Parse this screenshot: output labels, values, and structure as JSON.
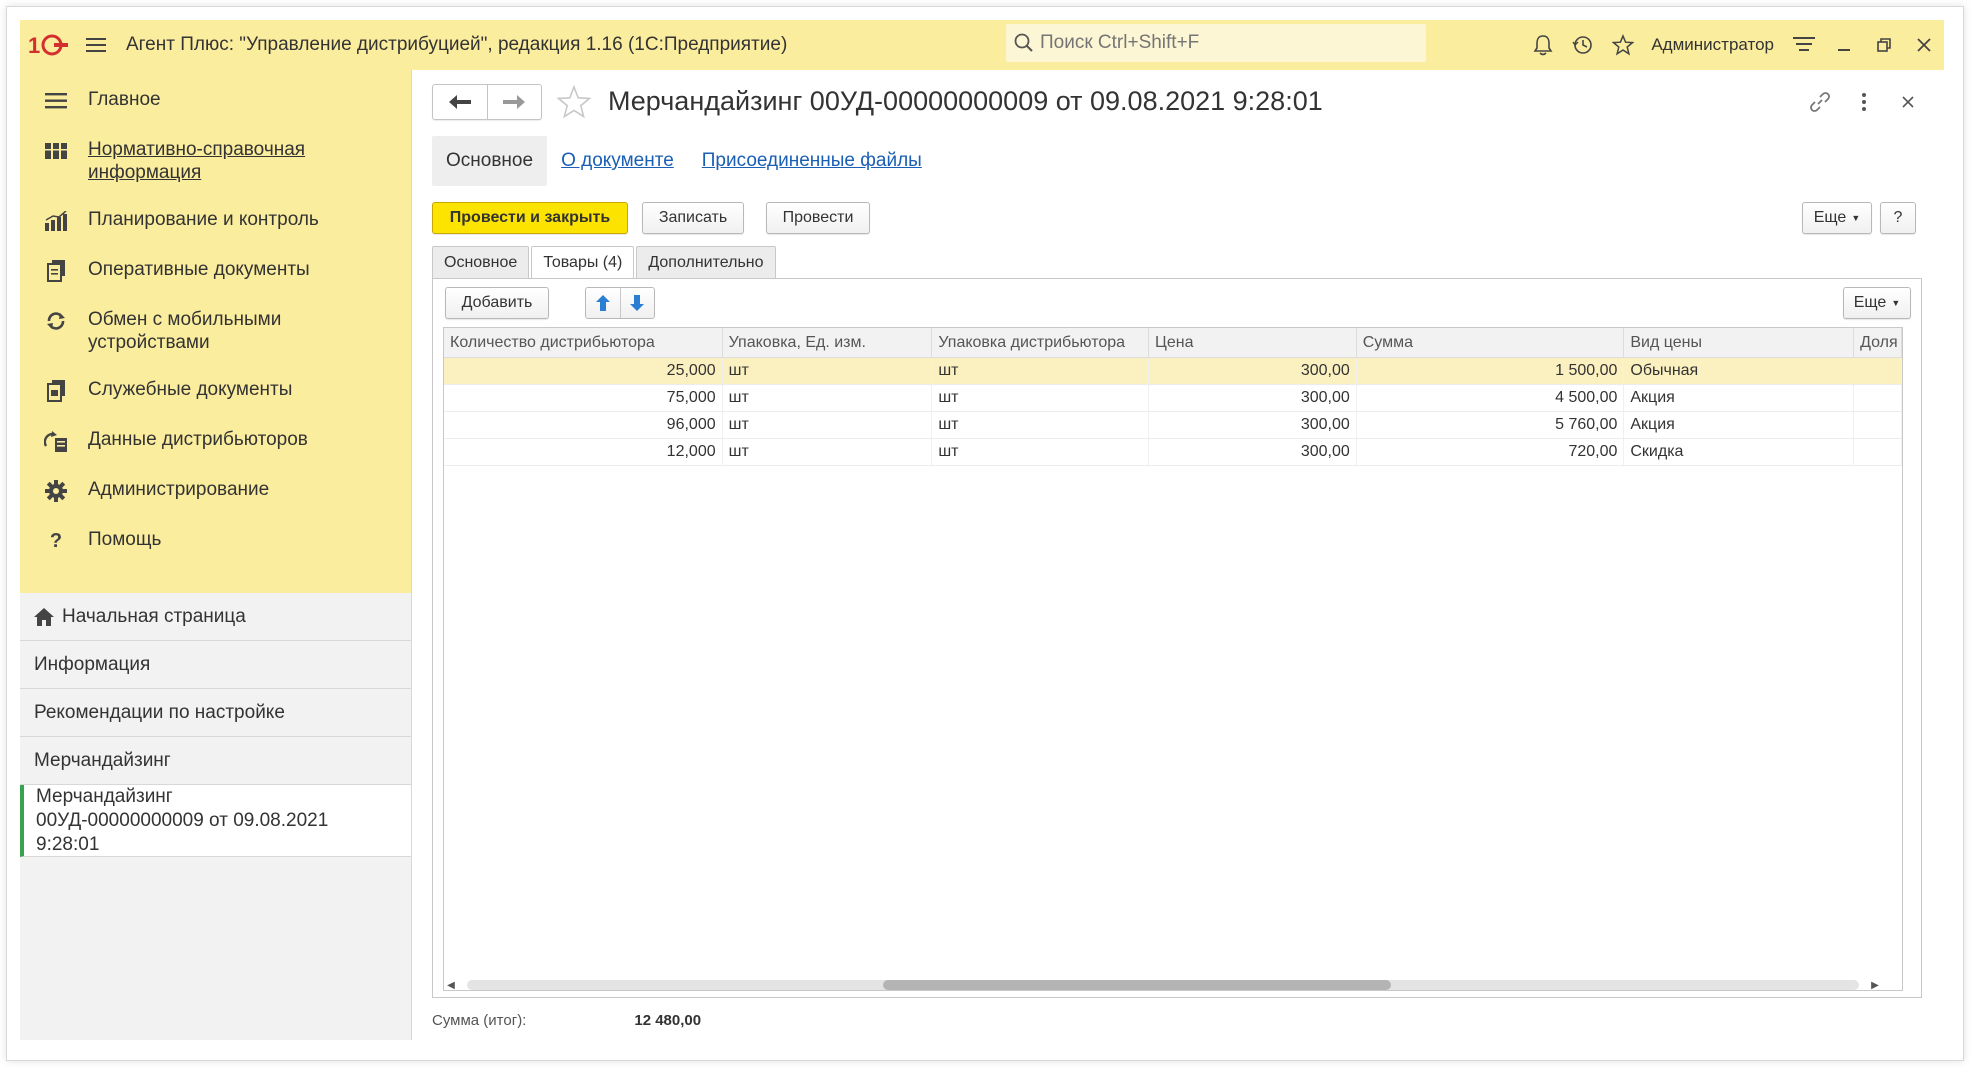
{
  "app": {
    "title": "Агент Плюс: \"Управление дистрибуцией\", редакция 1.16  (1С:Предприятие)",
    "search_placeholder": "Поиск Ctrl+Shift+F",
    "user": "Администратор",
    "brand_color": "#fbed9e"
  },
  "sidebar": {
    "sections": [
      {
        "label": "Главное",
        "icon": "menu-lines-icon"
      },
      {
        "label": "Нормативно-справочная информация",
        "icon": "catalog-grid-icon",
        "link": true
      },
      {
        "label": "Планирование и контроль",
        "icon": "bar-chart-icon"
      },
      {
        "label": "Оперативные документы",
        "icon": "documents-icon"
      },
      {
        "label": "Обмен с мобильными устройствами",
        "icon": "sync-icon"
      },
      {
        "label": "Служебные документы",
        "icon": "service-docs-icon"
      },
      {
        "label": "Данные дистрибьюторов",
        "icon": "distributor-data-icon"
      },
      {
        "label": "Администрирование",
        "icon": "gear-icon"
      },
      {
        "label": "Помощь",
        "icon": "question-icon"
      }
    ],
    "open_windows": [
      {
        "label": "Начальная страница",
        "icon": "home-icon"
      },
      {
        "label": "Информация"
      },
      {
        "label": "Рекомендации по настройке"
      },
      {
        "label": "Мерчандайзинг"
      },
      {
        "label": "Мерчандайзинг 00УД-00000000009 от 09.08.2021 9:28:01",
        "active": true
      }
    ]
  },
  "document": {
    "title": "Мерчандайзинг 00УД-00000000009 от 09.08.2021 9:28:01",
    "form_tabs": [
      "Основное",
      "О документе",
      "Присоединенные файлы"
    ],
    "commands": {
      "post_close": "Провести и закрыть",
      "save": "Записать",
      "post": "Провести",
      "more": "Еще",
      "help": "?"
    },
    "page_tabs": [
      "Основное",
      "Товары (4)",
      "Дополнительно"
    ],
    "table_commands": {
      "add": "Добавить",
      "more": "Еще"
    },
    "table": {
      "columns": [
        "Количество дистрибьютора",
        "Упаковка, Ед. изм.",
        "Упаковка дистрибьютора",
        "Цена",
        "Сумма",
        "Вид цены",
        "Доля"
      ],
      "rows": [
        [
          "25,000",
          "шт",
          "шт",
          "300,00",
          "1 500,00",
          "Обычная",
          ""
        ],
        [
          "75,000",
          "шт",
          "шт",
          "300,00",
          "4 500,00",
          "Акция",
          ""
        ],
        [
          "96,000",
          "шт",
          "шт",
          "300,00",
          "5 760,00",
          "Акция",
          ""
        ],
        [
          "12,000",
          "шт",
          "шт",
          "300,00",
          "720,00",
          "Скидка",
          ""
        ]
      ]
    },
    "total_label": "Сумма (итог):",
    "total_value": "12 480,00"
  }
}
